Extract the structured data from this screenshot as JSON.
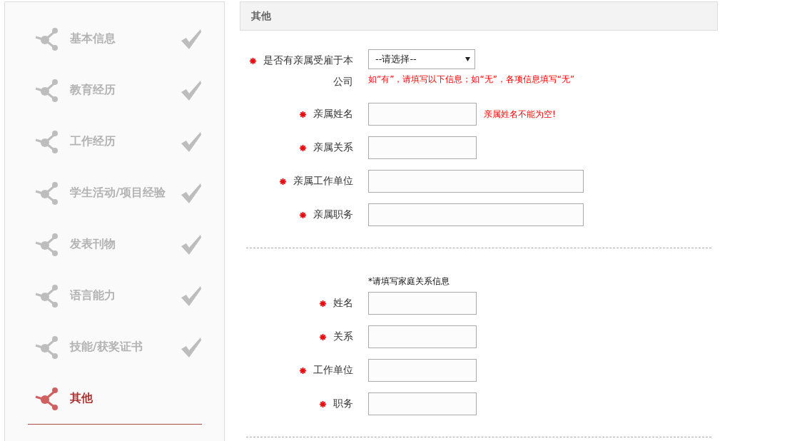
{
  "sidebar": {
    "items": [
      {
        "label": "基本信息",
        "selected": false,
        "completed": true
      },
      {
        "label": "教育经历",
        "selected": false,
        "completed": true
      },
      {
        "label": "工作经历",
        "selected": false,
        "completed": true
      },
      {
        "label": "学生活动/项目经验",
        "selected": false,
        "completed": true
      },
      {
        "label": "发表刊物",
        "selected": false,
        "completed": true
      },
      {
        "label": "语言能力",
        "selected": false,
        "completed": true
      },
      {
        "label": "技能/获奖证书",
        "selected": false,
        "completed": true
      },
      {
        "label": "其他",
        "selected": true,
        "completed": false
      }
    ]
  },
  "panel": {
    "title": "其他",
    "sections": [
      {
        "fields": [
          {
            "kind": "select",
            "label": "是否有亲属受雇于本公司",
            "required": true,
            "value": "--请选择--",
            "hint": "如“有”，请填写以下信息；如“无”，各项信息填写“无”"
          },
          {
            "kind": "input",
            "label": "亲属姓名",
            "required": true,
            "error": "亲属姓名不能为空!"
          },
          {
            "kind": "input",
            "label": "亲属关系",
            "required": true
          },
          {
            "kind": "wideinput",
            "label": "亲属工作单位",
            "required": true
          },
          {
            "kind": "wideinput",
            "label": "亲属职务",
            "required": true
          }
        ]
      },
      {
        "note": "*请填写家庭关系信息",
        "fields": [
          {
            "kind": "input",
            "label": "姓名",
            "required": true
          },
          {
            "kind": "input",
            "label": "关系",
            "required": true
          },
          {
            "kind": "input",
            "label": "工作单位",
            "required": true
          },
          {
            "kind": "input",
            "label": "职务",
            "required": true
          }
        ]
      }
    ]
  }
}
